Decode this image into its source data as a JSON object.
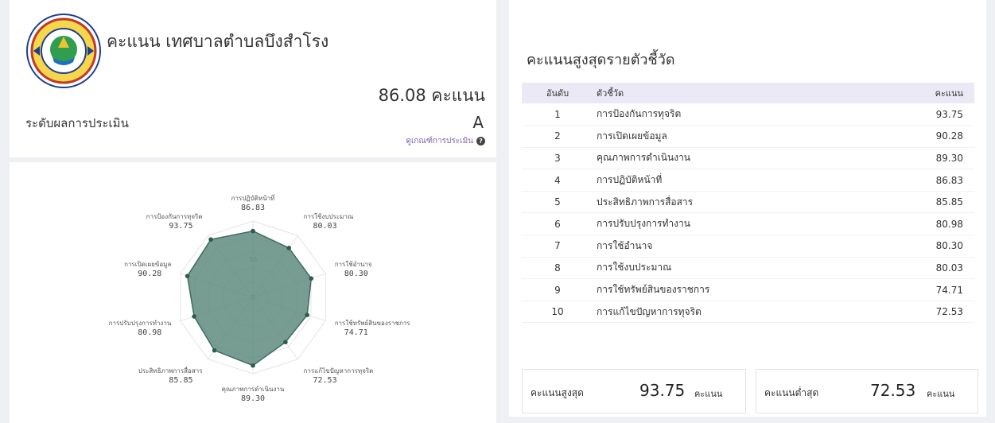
{
  "summary": {
    "org_title": "คะแนน เทศบาลตำบลบึงสำโรง",
    "total_score": "86.08 คะแนน",
    "level_label": "ระดับผลการประเมิน",
    "grade": "A",
    "criteria_link": "ดูเกณฑ์การประเมิน",
    "logo_icon": "municipality-seal-icon",
    "help_icon": "question-circle-icon",
    "link_color": "#7a5fae"
  },
  "radar": {
    "fill_color": "#5f8c80",
    "ticks": [
      "0",
      "50"
    ],
    "axes": [
      {
        "label": "การปฏิบัติหน้าที่",
        "value": "86.83"
      },
      {
        "label": "การใช้งบประมาณ",
        "value": "80.03"
      },
      {
        "label": "การใช้อำนาจ",
        "value": "80.30"
      },
      {
        "label": "การใช้ทรัพย์สินของราชการ",
        "value": "74.71"
      },
      {
        "label": "การแก้ไขปัญหาการทุจริต",
        "value": "72.53"
      },
      {
        "label": "คุณภาพการดำเนินงาน",
        "value": "89.30"
      },
      {
        "label": "ประสิทธิภาพการสื่อสาร",
        "value": "85.85"
      },
      {
        "label": "การปรับปรุงการทำงาน",
        "value": "80.98"
      },
      {
        "label": "การเปิดเผยข้อมูล",
        "value": "90.28"
      },
      {
        "label": "การป้องกันการทุจริต",
        "value": "93.75"
      }
    ]
  },
  "chart_data": {
    "type": "radar",
    "categories": [
      "การปฏิบัติหน้าที่",
      "การใช้งบประมาณ",
      "การใช้อำนาจ",
      "การใช้ทรัพย์สินของราชการ",
      "การแก้ไขปัญหาการทุจริต",
      "คุณภาพการดำเนินงาน",
      "ประสิทธิภาพการสื่อสาร",
      "การปรับปรุงการทำงาน",
      "การเปิดเผยข้อมูล",
      "การป้องกันการทุจริต"
    ],
    "values": [
      86.83,
      80.03,
      80.3,
      74.71,
      72.53,
      89.3,
      85.85,
      80.98,
      90.28,
      93.75
    ],
    "ylim": [
      0,
      100
    ],
    "tick_labels": [
      "0",
      "50"
    ],
    "grid": true
  },
  "ranking": {
    "title": "คะแนนสูงสุดรายตัวชี้วัด",
    "headers": {
      "rank": "อันดับ",
      "indicator": "ตัวชี้วัด",
      "score": "คะแนน"
    },
    "rows": [
      {
        "rank": "1",
        "name": "การป้องกันการทุจริต",
        "score": "93.75"
      },
      {
        "rank": "2",
        "name": "การเปิดเผยข้อมูล",
        "score": "90.28"
      },
      {
        "rank": "3",
        "name": "คุณภาพการดำเนินงาน",
        "score": "89.30"
      },
      {
        "rank": "4",
        "name": "การปฏิบัติหน้าที่",
        "score": "86.83"
      },
      {
        "rank": "5",
        "name": "ประสิทธิภาพการสื่อสาร",
        "score": "85.85"
      },
      {
        "rank": "6",
        "name": "การปรับปรุงการทำงาน",
        "score": "80.98"
      },
      {
        "rank": "7",
        "name": "การใช้อำนาจ",
        "score": "80.30"
      },
      {
        "rank": "8",
        "name": "การใช้งบประมาณ",
        "score": "80.03"
      },
      {
        "rank": "9",
        "name": "การใช้ทรัพย์สินของราชการ",
        "score": "74.71"
      },
      {
        "rank": "10",
        "name": "การแก้ไขปัญหาการทุจริต",
        "score": "72.53"
      }
    ],
    "header_bg": "#ebe9f6"
  },
  "stats": {
    "max": {
      "label": "คะแนนสูงสุด",
      "value": "93.75",
      "unit": "คะแนน"
    },
    "min": {
      "label": "คะแนนต่ำสุด",
      "value": "72.53",
      "unit": "คะแนน"
    }
  }
}
